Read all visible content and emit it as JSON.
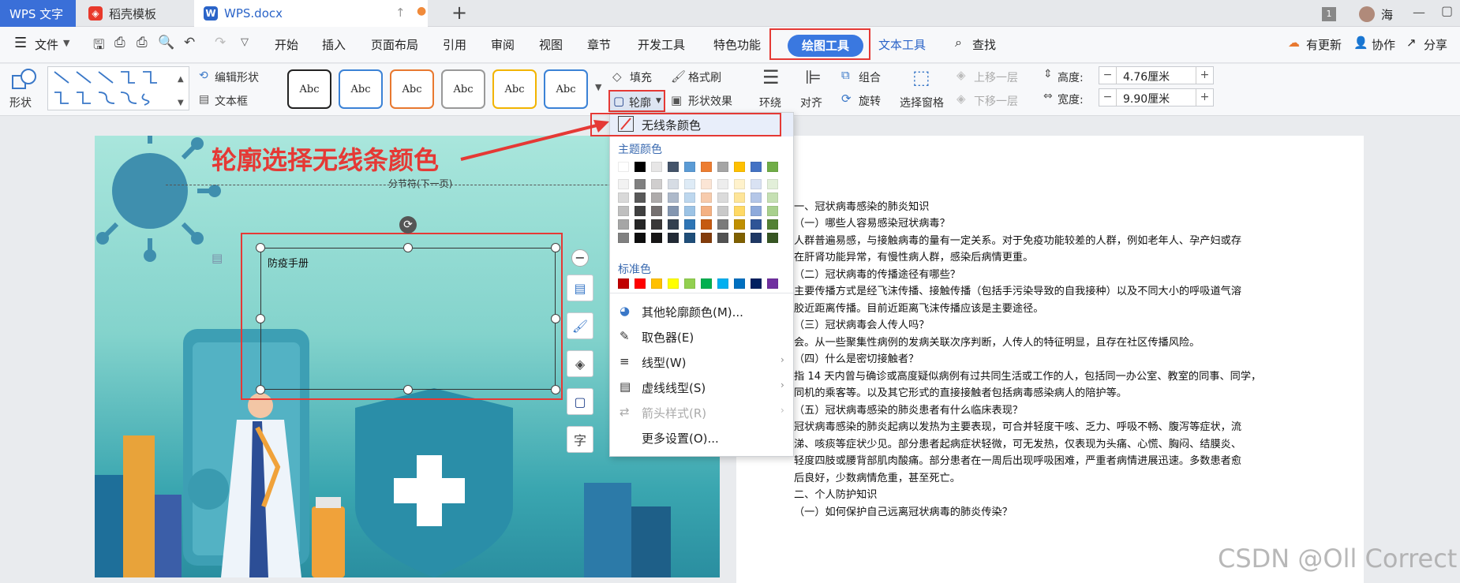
{
  "tabs": {
    "wps": "WPS 文字",
    "daoke": "稻壳模板",
    "doc": "WPS.docx",
    "user": "海"
  },
  "menu": {
    "file": "文件",
    "items": [
      "开始",
      "插入",
      "页面布局",
      "引用",
      "审阅",
      "视图",
      "章节",
      "开发工具",
      "特色功能"
    ],
    "drawing": "绘图工具",
    "text_tool": "文本工具",
    "search": "查找",
    "update": "有更新",
    "collab": "协作",
    "share": "分享"
  },
  "ribbon": {
    "shape": "形状",
    "edit_shape": "编辑形状",
    "textbox": "文本框",
    "style_label": "Abc",
    "fill": "填充",
    "format_painter": "格式刷",
    "outline": "轮廓",
    "shape_effect": "形状效果",
    "wrap": "环绕",
    "align": "对齐",
    "group": "组合",
    "rotate": "旋转",
    "select_pane": "选择窗格",
    "bring_forward": "上移一层",
    "send_backward": "下移一层",
    "height_label": "高度:",
    "height_value": "4.76厘米",
    "width_label": "宽度:",
    "width_value": "9.90厘米"
  },
  "styles": [
    {
      "border": "#222"
    },
    {
      "border": "#3b82d6"
    },
    {
      "border": "#e8782f"
    },
    {
      "border": "#999"
    },
    {
      "border": "#f2b400"
    },
    {
      "border": "#3b82d6"
    }
  ],
  "annotation": "轮廓选择无线条颜色",
  "section_break": "分节符(下一页)",
  "textbox_content": "防疫手册",
  "dropdown": {
    "no_line": "无线条颜色",
    "theme_colors": "主题颜色",
    "standard_colors": "标准色",
    "more_colors": "其他轮廓颜色(M)...",
    "eyedropper": "取色器(E)",
    "line_type": "线型(W)",
    "dash_type": "虚线线型(S)",
    "arrow_style": "箭头样式(R)",
    "more_settings": "更多设置(O)..."
  },
  "theme_top": [
    "#ffffff",
    "#000000",
    "#e7e6e6",
    "#44546a",
    "#5b9bd5",
    "#ed7d31",
    "#a5a5a5",
    "#ffc000",
    "#4472c4",
    "#70ad47"
  ],
  "theme_shades": [
    [
      "#f2f2f2",
      "#808080",
      "#d0cece",
      "#d6dce4",
      "#deebf6",
      "#fbe5d5",
      "#ededed",
      "#fff2cc",
      "#d9e2f3",
      "#e2efd9"
    ],
    [
      "#d9d9d9",
      "#595959",
      "#aeabab",
      "#adb9ca",
      "#bdd7ee",
      "#f7cbac",
      "#dbdbdb",
      "#fee599",
      "#b4c6e7",
      "#c5e0b3"
    ],
    [
      "#bfbfbf",
      "#404040",
      "#757070",
      "#8496b0",
      "#9cc3e5",
      "#f4b183",
      "#c9c9c9",
      "#ffd965",
      "#8eaadb",
      "#a8d08d"
    ],
    [
      "#a6a6a6",
      "#262626",
      "#3a3838",
      "#323f4f",
      "#2e75b5",
      "#c55a11",
      "#7b7b7b",
      "#bf8f00",
      "#2f5496",
      "#538135"
    ],
    [
      "#808080",
      "#0d0d0d",
      "#171616",
      "#222a35",
      "#1f4e79",
      "#833c0b",
      "#525252",
      "#7f6000",
      "#1f3864",
      "#375623"
    ]
  ],
  "standard": [
    "#c00000",
    "#ff0000",
    "#ffc000",
    "#ffff00",
    "#92d050",
    "#00b050",
    "#00b0f0",
    "#0070c0",
    "#002060",
    "#7030a0"
  ],
  "doc_lines": [
    "一、冠状病毒感染的肺炎知识",
    "（一）哪些人容易感染冠状病毒？",
    "人群普遍易感，与接触病毒的量有一定关系。对于免疫功能较差的人群，例如老年人、孕产妇或存",
    "在肝肾功能异常，有慢性病人群，感染后病情更重。",
    "（二）冠状病毒的传播途径有哪些？",
    "主要传播方式是经飞沫传播、接触传播（包括手污染导致的自我接种）以及不同大小的呼吸道气溶",
    "胶近距离传播。目前近距离飞沫传播应该是主要途径。",
    "（三）冠状病毒会人传人吗？",
    "会。从一些聚集性病例的发病关联次序判断，人传人的特征明显，且存在社区传播风险。",
    "（四）什么是密切接触者？",
    "指 14 天内曾与确诊或高度疑似病例有过共同生活或工作的人，包括同一办公室、教室的同事、同学，",
    "同机的乘客等。以及其它形式的直接接触者包括病毒感染病人的陪护等。",
    "（五）冠状病毒感染的肺炎患者有什么临床表现？",
    "冠状病毒感染的肺炎起病以发热为主要表现，可合并轻度干咳、乏力、呼吸不畅、腹泻等症状，流",
    "涕、咳痰等症状少见。部分患者起病症状轻微，可无发热，仅表现为头痛、心慌、胸闷、结膜炎、",
    "轻度四肢或腰背部肌肉酸痛。部分患者在一周后出现呼吸困难，严重者病情进展迅速。多数患者愈",
    "后良好，少数病情危重，甚至死亡。",
    "二、个人防护知识",
    "（一）如何保护自己远离冠状病毒的肺炎传染？"
  ],
  "watermark": "CSDN @Oll Correct"
}
